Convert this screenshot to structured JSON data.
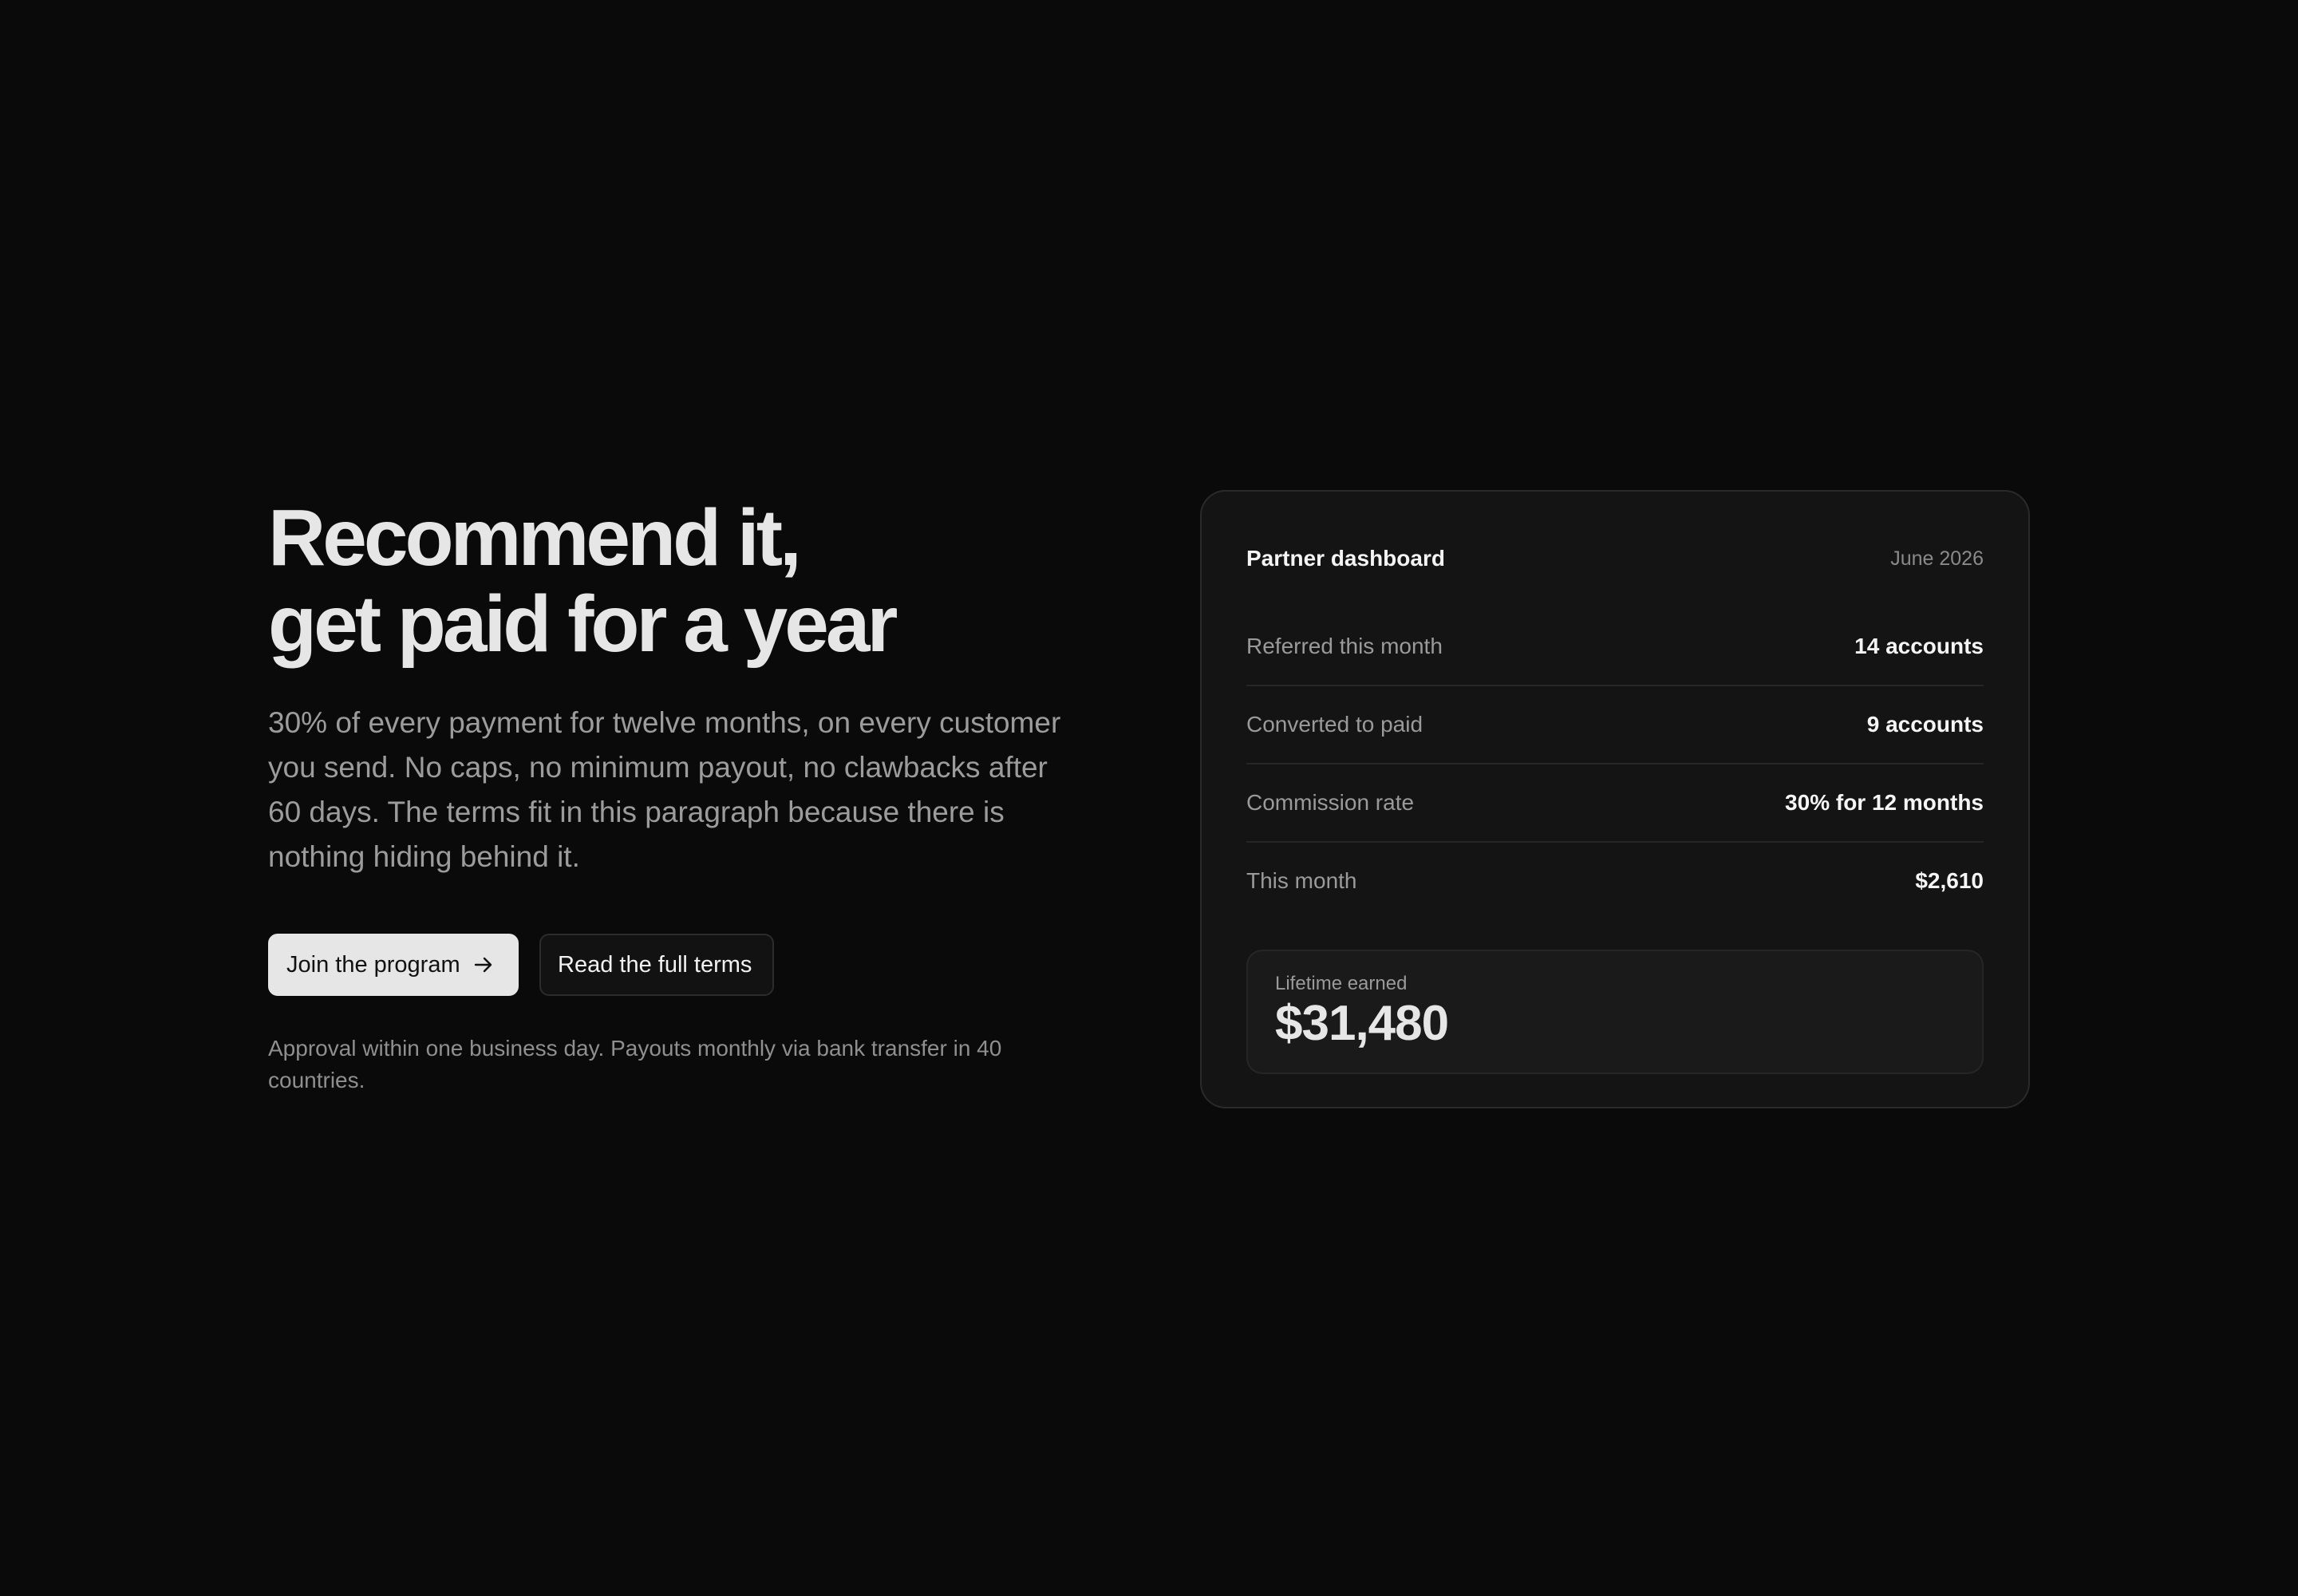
{
  "hero": {
    "headline_line1": "Recommend it,",
    "headline_line2": "get paid for a year",
    "lede": "30% of every payment for twelve months, on every customer you send. No caps, no minimum payout, no clawbacks after 60 days. The terms fit in this paragraph because there is nothing hiding behind it.",
    "primary_button": "Join the program",
    "primary_button_icon": "arrow-right-icon",
    "secondary_button": "Read the full terms",
    "note": "Approval within one business day. Payouts monthly via bank transfer in 40 countries."
  },
  "dashboard": {
    "title": "Partner dashboard",
    "date": "June 2026",
    "stats": [
      {
        "label": "Referred this month",
        "value": "14 accounts"
      },
      {
        "label": "Converted to paid",
        "value": "9 accounts"
      },
      {
        "label": "Commission rate",
        "value": "30% for 12 months"
      },
      {
        "label": "This month",
        "value": "$2,610"
      }
    ],
    "lifetime_label": "Lifetime earned",
    "lifetime_value": "$31,480"
  },
  "colors": {
    "background": "#0a0a0a",
    "card": "#141414",
    "primary_button": "#e6e6e6",
    "text_primary": "#e6e6e6",
    "text_muted": "#9c9c9c"
  }
}
